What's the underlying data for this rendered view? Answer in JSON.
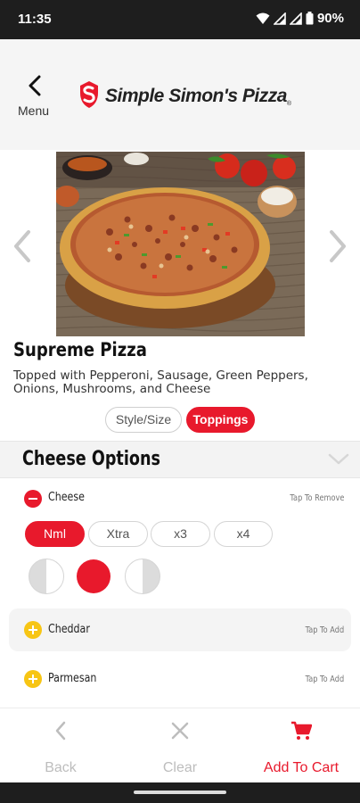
{
  "status_bar": {
    "time": "11:35",
    "battery": "90%"
  },
  "header": {
    "menu_label": "Menu",
    "brand_name": "Simple Simon's Pizza",
    "brand_mark": "®"
  },
  "product": {
    "title": "Supreme Pizza",
    "description": "Topped with Pepperoni, Sausage, Green Peppers, Onions, Mushrooms, and Cheese"
  },
  "tabs": [
    {
      "label": "Style/Size",
      "selected": false
    },
    {
      "label": "Toppings",
      "selected": true
    }
  ],
  "section": {
    "title": "Cheese Options"
  },
  "toppings": [
    {
      "name": "Cheese",
      "hint": "Tap To Remove",
      "icon": "minus-circle-icon",
      "amounts": [
        "Nml",
        "Xtra",
        "x3",
        "x4"
      ],
      "selected_amount": "Nml",
      "placement_selected": "whole"
    },
    {
      "name": "Cheddar",
      "hint": "Tap To Add",
      "icon": "plus-circle-icon"
    },
    {
      "name": "Parmesan",
      "hint": "Tap To Add",
      "icon": "plus-circle-icon"
    }
  ],
  "bottom_bar": {
    "back_label": "Back",
    "clear_label": "Clear",
    "cart_label": "Add To Cart"
  },
  "colors": {
    "accent": "#e8192c",
    "add_yellow": "#f7c514",
    "disabled_gray": "#bdbdbd"
  }
}
